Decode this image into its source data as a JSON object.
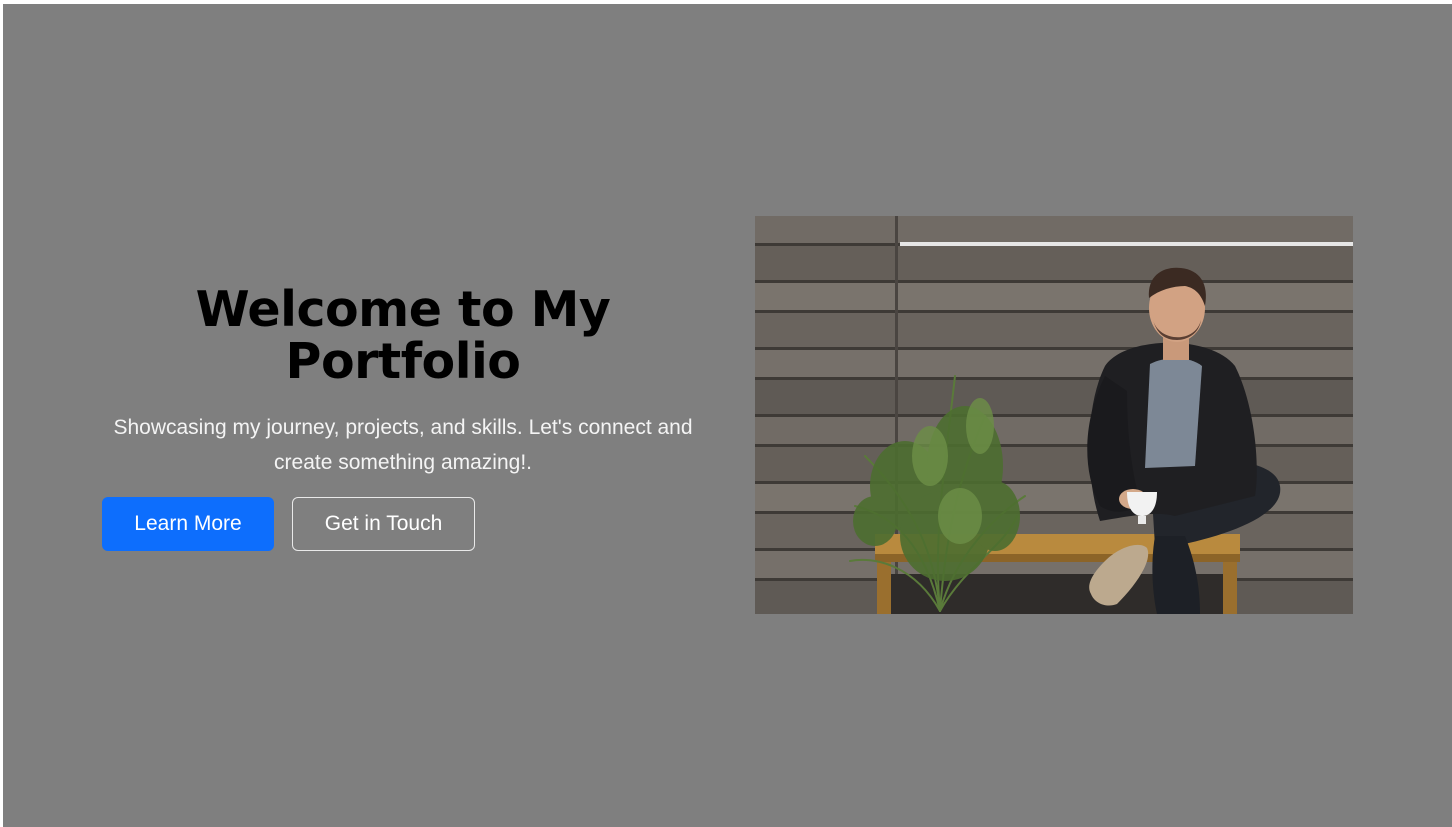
{
  "hero": {
    "title": "Welcome to My Portfolio",
    "subtitle": "Showcasing my journey, projects, and skills. Let's connect and create something amazing!.",
    "primary_button": "Learn More",
    "secondary_button": "Get in Touch"
  },
  "colors": {
    "background": "#7f7f7f",
    "primary_button": "#0d6efd",
    "title_text": "#000000",
    "subtitle_text": "#f4f4f4"
  }
}
